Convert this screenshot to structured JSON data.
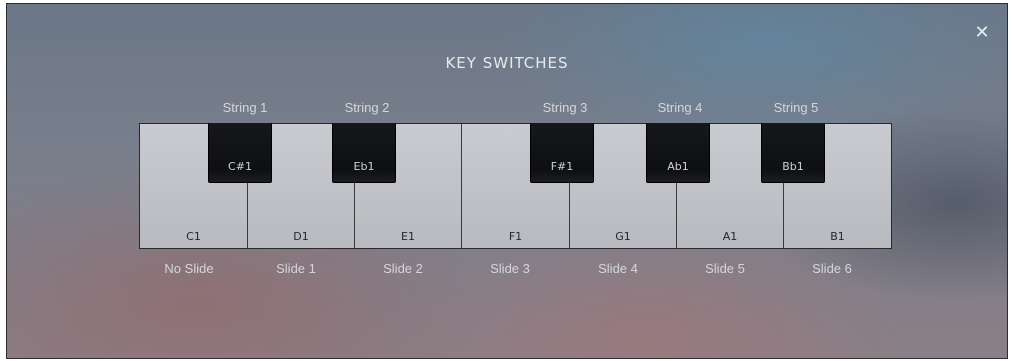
{
  "header": {
    "title": "KEY SWITCHES",
    "close_icon": "close-icon"
  },
  "keyboard": {
    "white_keys": [
      "C1",
      "D1",
      "E1",
      "F1",
      "G1",
      "A1",
      "B1"
    ],
    "black_keys": [
      "C#1",
      "Eb1",
      "F#1",
      "Ab1",
      "Bb1"
    ]
  },
  "string_labels": [
    "String 1",
    "String 2",
    "String 3",
    "String 4",
    "String 5"
  ],
  "slide_labels": [
    "No Slide",
    "Slide 1",
    "Slide 2",
    "Slide 3",
    "Slide 4",
    "Slide 5",
    "Slide 6"
  ]
}
